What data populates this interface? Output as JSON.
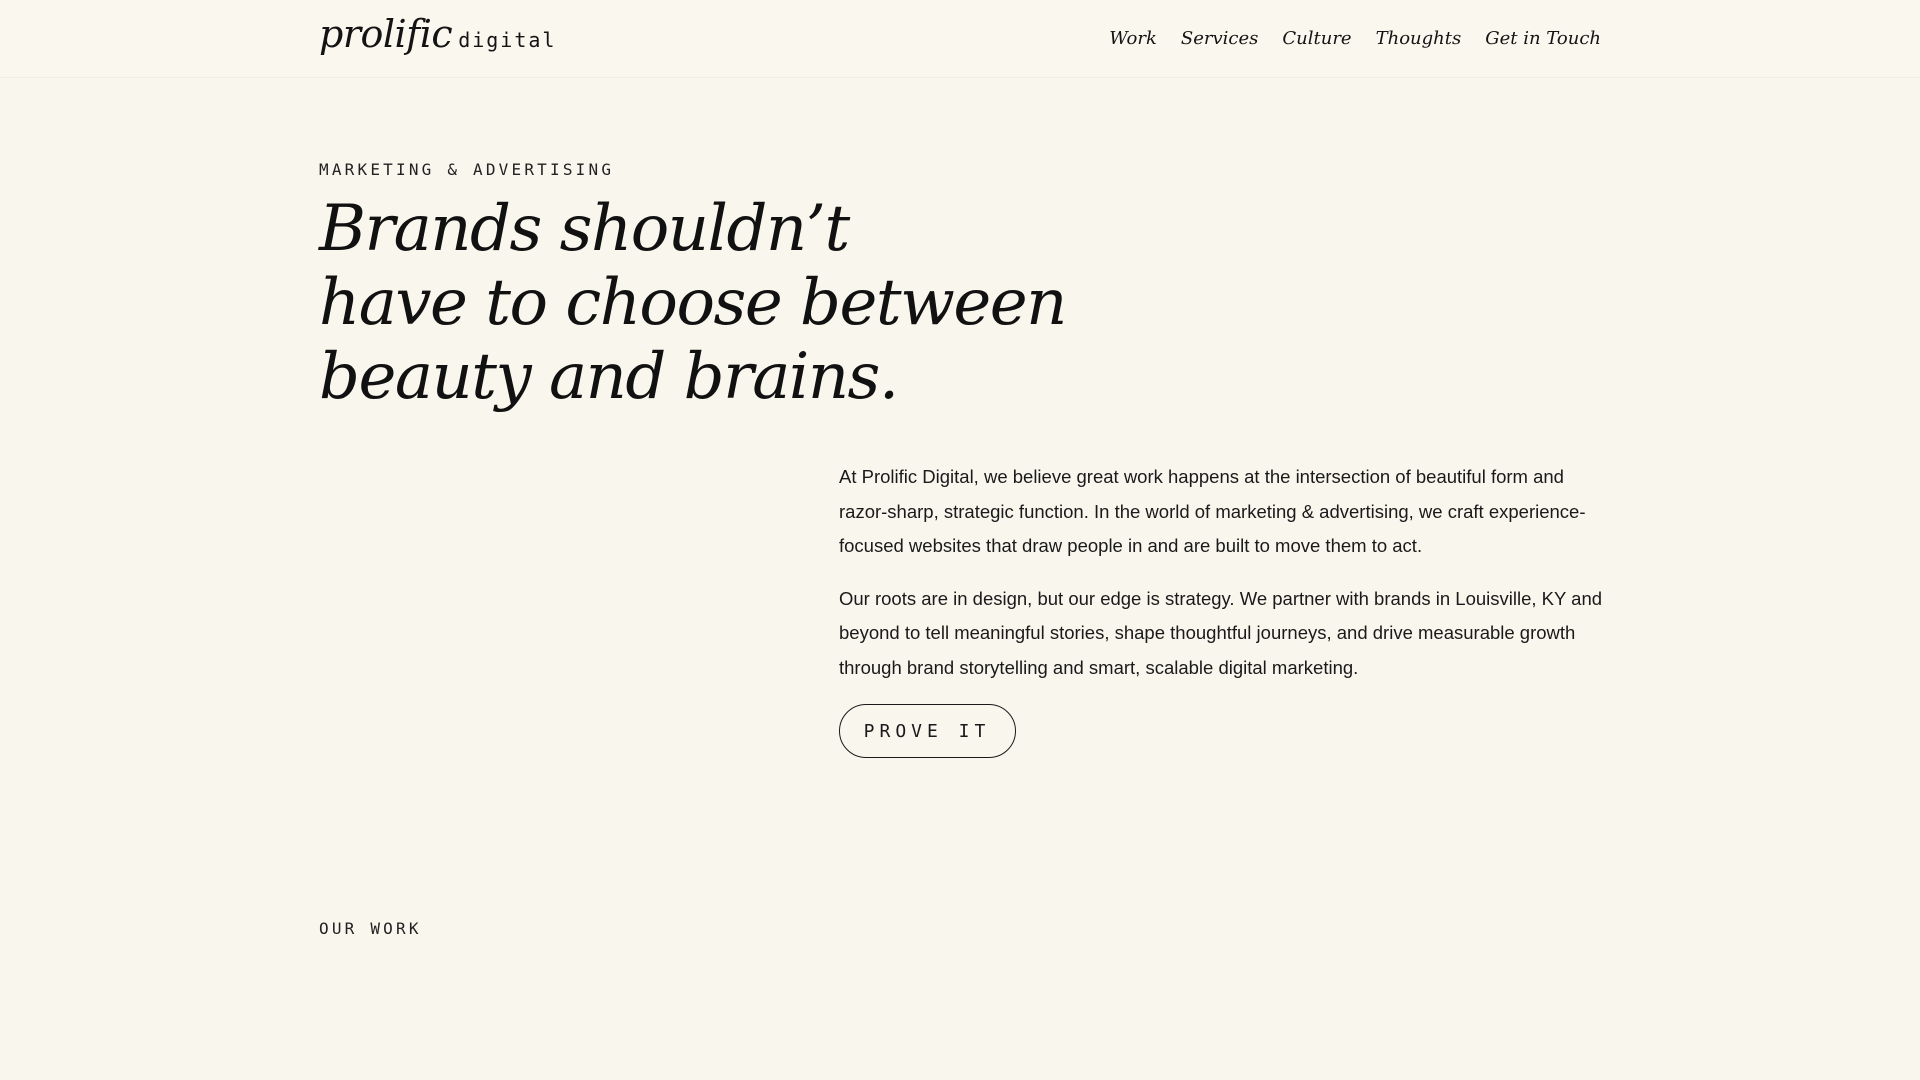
{
  "header": {
    "logo_word": "prolific",
    "logo_sub": "digital",
    "nav": [
      {
        "label": "Work"
      },
      {
        "label": "Services"
      },
      {
        "label": "Culture"
      },
      {
        "label": "Thoughts"
      },
      {
        "label": "Get in Touch"
      }
    ]
  },
  "hero": {
    "eyebrow": "MARKETING & ADVERTISING",
    "headline_lines": [
      "Brands shouldn’t",
      "have to choose between",
      "beauty and brains."
    ],
    "paragraphs": [
      "At Prolific Digital, we believe great work happens at the intersection of beautiful form and razor-sharp, strategic function. In the world of marketing & advertising, we craft experience-focused websites that draw people in and are built to move them to act.",
      "Our roots are in design, but our edge is strategy. We partner with brands in Louisville, KY and beyond to tell meaningful stories, shape thoughtful journeys, and drive measurable growth through brand storytelling and smart, scalable digital marketing."
    ],
    "cta_label": "PROVE IT"
  },
  "work_section": {
    "label": "OUR WORK"
  },
  "colors": {
    "background": "#f9f6ed",
    "text": "#161616"
  }
}
